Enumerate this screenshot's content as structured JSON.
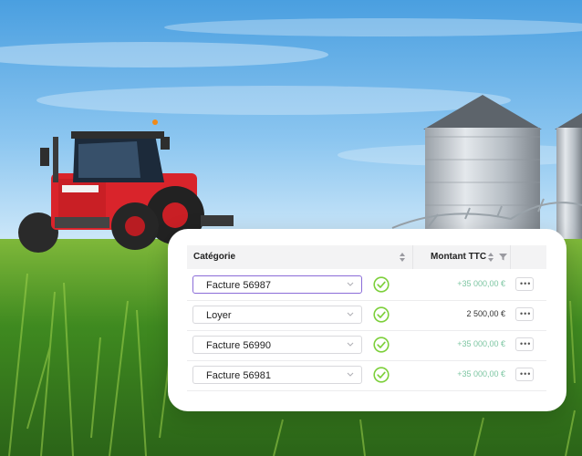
{
  "table": {
    "headers": {
      "category": "Catégorie",
      "amount": "Montant TTC"
    },
    "rows": [
      {
        "category": "Facture 56987",
        "amount": "+35 000,00 €",
        "amount_kind": "positive",
        "focused": true,
        "validated": true
      },
      {
        "category": "Loyer",
        "amount": "2 500,00 €",
        "amount_kind": "neutral",
        "focused": false,
        "validated": true
      },
      {
        "category": "Facture 56990",
        "amount": "+35 000,00 €",
        "amount_kind": "positive",
        "focused": false,
        "validated": true
      },
      {
        "category": "Facture 56981",
        "amount": "+35 000,00 €",
        "amount_kind": "positive",
        "focused": false,
        "validated": true
      }
    ]
  },
  "icons": {
    "sort": "sort-arrows-icon",
    "filter": "filter-icon",
    "chevron": "chevron-down-icon",
    "check": "check-circle-icon",
    "more": "more-horizontal-icon"
  },
  "colors": {
    "check_green": "#7ccf3a",
    "positive_amount": "#7dc6a2",
    "focus_border": "#8b6cd8"
  }
}
